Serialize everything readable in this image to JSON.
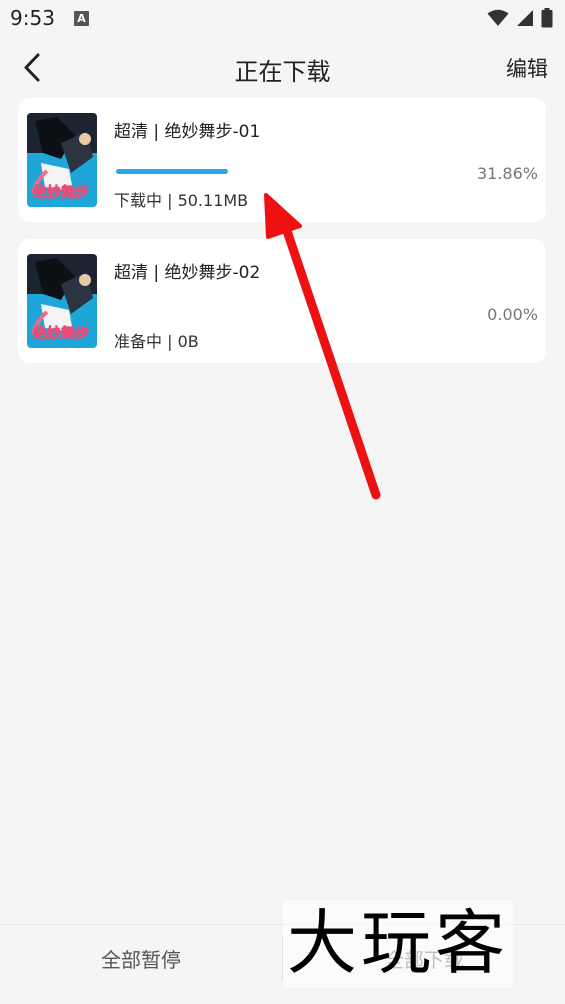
{
  "status_bar": {
    "time": "9:53",
    "icons": [
      "a-notification-icon",
      "wifi-icon",
      "signal-icon",
      "battery-icon"
    ]
  },
  "header": {
    "title": "正在下载",
    "edit_label": "编辑",
    "back_icon": "chevron-left-icon"
  },
  "downloads": [
    {
      "title": "超清 | 绝妙舞步-01",
      "status": "下载中 | 50.11MB",
      "percent": "31.86%",
      "progress": 0.3186,
      "cover_icon": "poster-thumbnail"
    },
    {
      "title": "超清 | 绝妙舞步-02",
      "status": "准备中 | 0B",
      "percent": "0.00%",
      "progress": 0,
      "cover_icon": "poster-thumbnail"
    }
  ],
  "bottom_bar": {
    "pause_all": "全部暂停",
    "download_all": "全部下载"
  },
  "watermark": "大玩客",
  "colors": {
    "background": "#f5f5f5",
    "card": "#ffffff",
    "progress": "#2aa8ea",
    "annotation_arrow": "#ee1111"
  }
}
